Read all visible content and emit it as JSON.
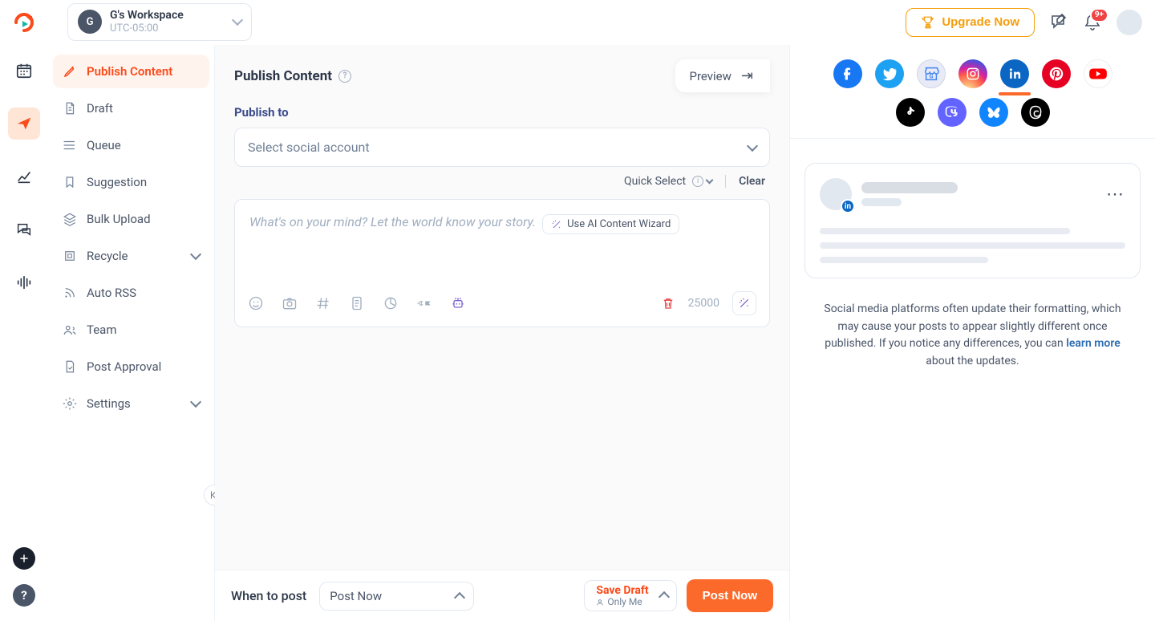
{
  "workspace": {
    "initial": "G",
    "name": "G's Workspace",
    "timezone": "UTC-05:00"
  },
  "upgrade": {
    "label": "Upgrade Now"
  },
  "notifications": {
    "badge": "9+"
  },
  "sidenav": {
    "items": [
      {
        "label": "Publish Content"
      },
      {
        "label": "Draft"
      },
      {
        "label": "Queue"
      },
      {
        "label": "Suggestion"
      },
      {
        "label": "Bulk Upload"
      },
      {
        "label": "Recycle"
      },
      {
        "label": "Auto RSS"
      },
      {
        "label": "Team"
      },
      {
        "label": "Post Approval"
      },
      {
        "label": "Settings"
      }
    ]
  },
  "main": {
    "title": "Publish Content",
    "preview_label": "Preview",
    "publish_to_label": "Publish to",
    "select_placeholder": "Select social account",
    "quick_select": "Quick Select",
    "clear": "Clear",
    "composer_placeholder": "What's on your mind? Let the world know your story.",
    "ai_wizard": "Use AI Content Wizard",
    "char_count": "25000"
  },
  "footer": {
    "when_label": "When to post",
    "when_value": "Post Now",
    "save_draft": "Save Draft",
    "only_me": "Only Me",
    "post_now": "Post Now"
  },
  "right": {
    "note_part1": "Social media platforms often update their formatting, which may cause your posts to appear slightly different once published. If you notice any differences, you can ",
    "note_link": "learn more",
    "note_part2": " about the updates."
  }
}
